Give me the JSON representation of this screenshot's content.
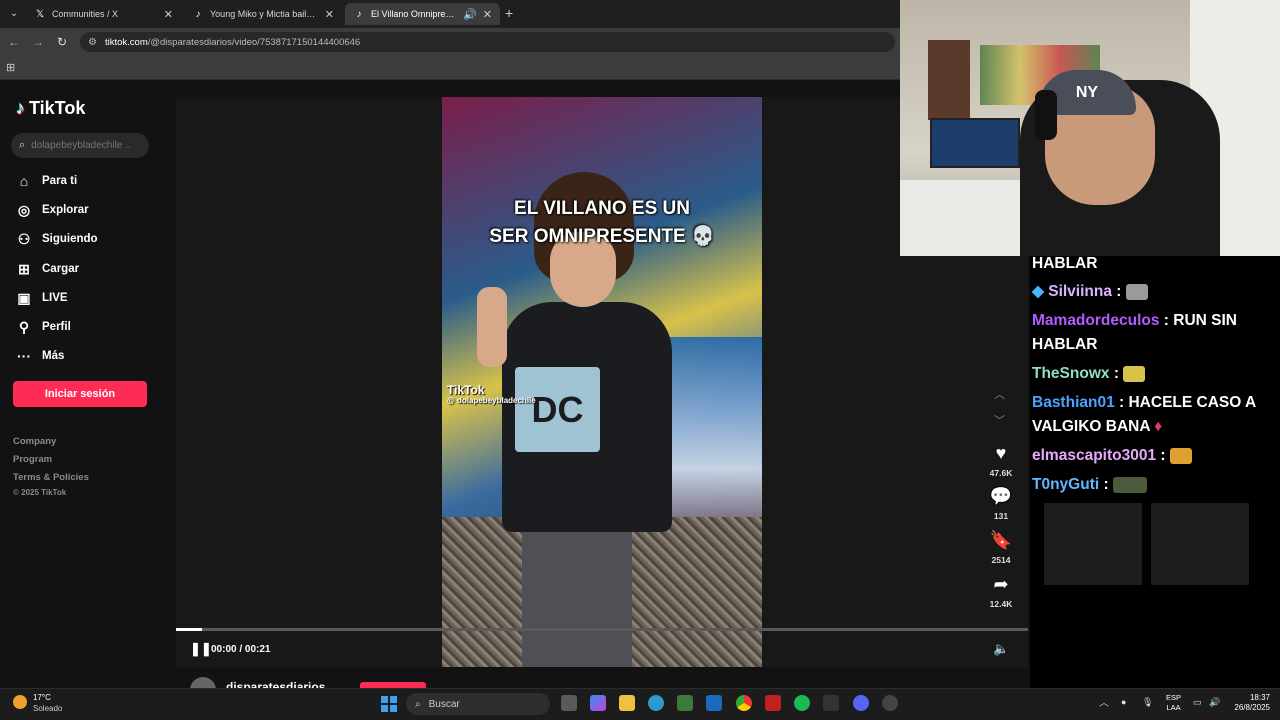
{
  "browser": {
    "tabs": [
      {
        "title": "Communities / X",
        "icon": "x-logo-icon"
      },
      {
        "title": "Young Miko y Mictia bailando e",
        "icon": "tiktok-icon"
      },
      {
        "title": "El Villano Omnipresente en",
        "icon": "tiktok-icon",
        "active": true
      }
    ],
    "url_host": "tiktok.com",
    "url_path": "/@disparatesdiarios/video/7538717150144400646"
  },
  "tiktok": {
    "logo_text": "TikTok",
    "search_placeholder": "dolapebeybladechile ...",
    "nav": [
      {
        "label": "Para ti",
        "icon": "home-icon"
      },
      {
        "label": "Explorar",
        "icon": "compass-icon"
      },
      {
        "label": "Siguiendo",
        "icon": "following-icon"
      },
      {
        "label": "Cargar",
        "icon": "upload-icon"
      },
      {
        "label": "LIVE",
        "icon": "live-icon"
      },
      {
        "label": "Perfil",
        "icon": "profile-icon"
      },
      {
        "label": "Más",
        "icon": "more-icon"
      }
    ],
    "login_label": "Iniciar sesión",
    "footer": [
      "Company",
      "Program",
      "Terms & Policies"
    ],
    "copyright": "© 2025 TikTok",
    "video": {
      "caption_line1": "EL VILLANO ES UN",
      "caption_line2": "SER OMNIPRESENTE 💀",
      "watermark": "TikTok",
      "watermark_user": "@ dolapebeybladechile",
      "likes": "47.6K",
      "comments": "131",
      "saves": "2514",
      "shares": "12.4K",
      "time": "00:00 / 00:21",
      "progress": 0.03,
      "author": "disparatesdiarios"
    }
  },
  "chat": [
    {
      "user": "",
      "message": "HABLAR",
      "color": "#ffffff"
    },
    {
      "user": "Silviinna",
      "message": ":",
      "color": "#d8b4ff",
      "badge": true
    },
    {
      "user": "Mamadordeculos",
      "message": ": RUN SIN HABLAR",
      "color": "#b25cff"
    },
    {
      "user": "TheSnowx",
      "message": ":",
      "color": "#8ee0c0"
    },
    {
      "user": "Basthian01",
      "message": ": HACELE CASO A VALGIKO BANA",
      "color": "#4aa3ff"
    },
    {
      "user": "elmascapito3001",
      "message": ":",
      "color": "#e8a8ff"
    },
    {
      "user": "T0nyGuti",
      "message": ":",
      "color": "#60b8ff"
    }
  ],
  "taskbar": {
    "temp": "17°C",
    "weather": "Soleado",
    "search": "Buscar",
    "lang_top": "ESP",
    "lang_bottom": "LAA",
    "time": "18:37",
    "date": "26/8/2025"
  },
  "colors": {
    "accent": "#fe2c55",
    "bg": "#121212"
  }
}
